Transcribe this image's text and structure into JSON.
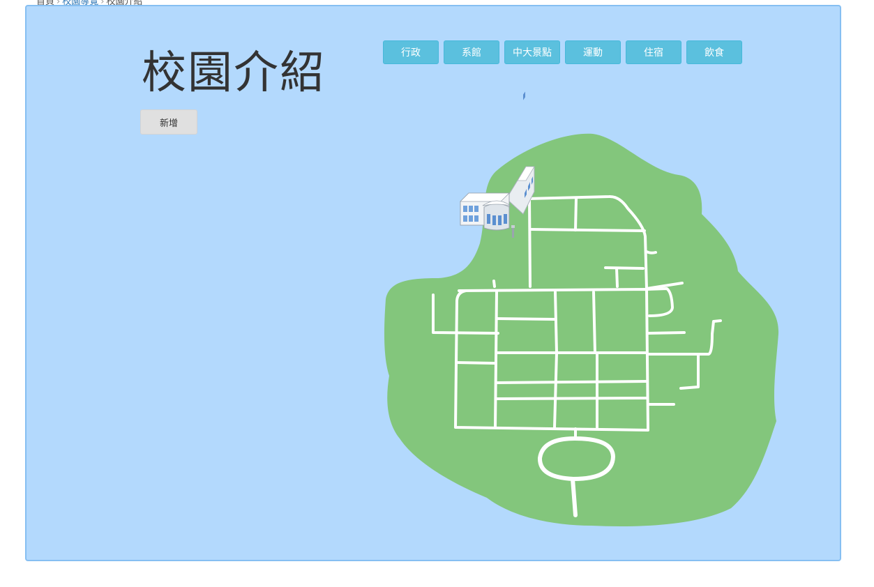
{
  "breadcrumb": {
    "home": "首頁",
    "section": "校園導覽",
    "current": "校園介紹",
    "separator": "›"
  },
  "page": {
    "title": "校園介紹",
    "add_label": "新增"
  },
  "categories": [
    {
      "label": "行政"
    },
    {
      "label": "系館"
    },
    {
      "label": "中大景點"
    },
    {
      "label": "運動"
    },
    {
      "label": "住宿"
    },
    {
      "label": "飲食"
    }
  ],
  "colors": {
    "panel_bg": "#b3d9fd",
    "panel_border": "#86bff2",
    "island": "#83c67c",
    "roads": "#ffffff",
    "category_button": "#5bc0de",
    "add_button": "#e0e0e0"
  },
  "map": {
    "marker_icon": "administration-building-icon"
  }
}
